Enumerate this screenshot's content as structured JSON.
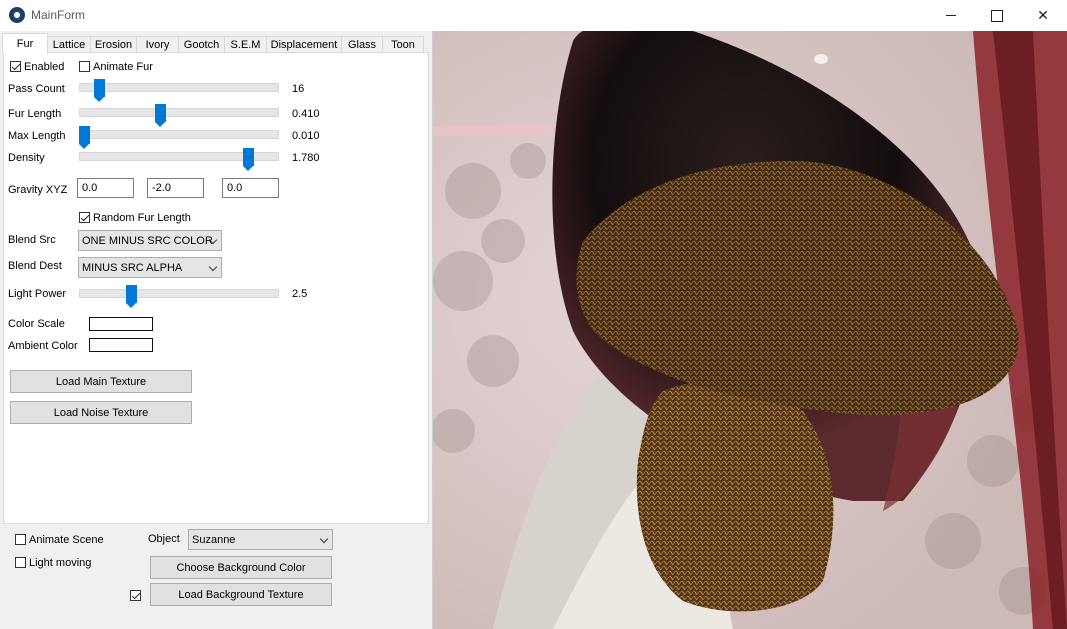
{
  "window": {
    "title": "MainForm",
    "minimize_symbol": "",
    "close_symbol": "✕"
  },
  "tabs": [
    "Fur",
    "Lattice",
    "Erosion",
    "Ivory",
    "Gootch",
    "S.E.M",
    "Displacement",
    "Glass",
    "Toon"
  ],
  "fur": {
    "enabled_label": "Enabled",
    "enabled_checked": true,
    "animate_fur_label": "Animate Fur",
    "animate_fur_checked": false,
    "sliders": [
      {
        "label": "Pass Count",
        "value": "16",
        "level": 0.08
      },
      {
        "label": "Fur Length",
        "value": "0.410",
        "level": 0.4
      },
      {
        "label": "Max Length",
        "value": "0.010",
        "level": 0.0
      },
      {
        "label": "Density",
        "value": "1.780",
        "level": 0.87
      }
    ],
    "gravity_label": "Gravity XYZ",
    "gravity": [
      "0.0",
      "-2.0",
      "0.0"
    ],
    "random_fur_length_label": "Random Fur Length",
    "random_fur_length_checked": true,
    "blend_src_label": "Blend Src",
    "blend_src_value": "ONE MINUS SRC COLOR",
    "blend_dest_label": "Blend Dest",
    "blend_dest_value": "MINUS SRC ALPHA",
    "light_power": {
      "label": "Light Power",
      "value": "2.5",
      "level": 0.25
    },
    "color_scale_label": "Color Scale",
    "ambient_color_label": "Ambient Color",
    "load_main_texture": "Load Main Texture",
    "load_noise_texture": "Load Noise Texture"
  },
  "bottom": {
    "animate_scene_label": "Animate Scene",
    "animate_scene_checked": false,
    "light_moving_label": "Light moving",
    "light_moving_checked": false,
    "object_label": "Object",
    "object_value": "Suzanne",
    "choose_bg_color": "Choose Background Color",
    "bg_texture_checked": true,
    "load_bg_texture": "Load Background Texture"
  },
  "colors": {
    "accent": "#0078d7",
    "fur": "#6b4520",
    "panel": "#f0f0f0"
  }
}
